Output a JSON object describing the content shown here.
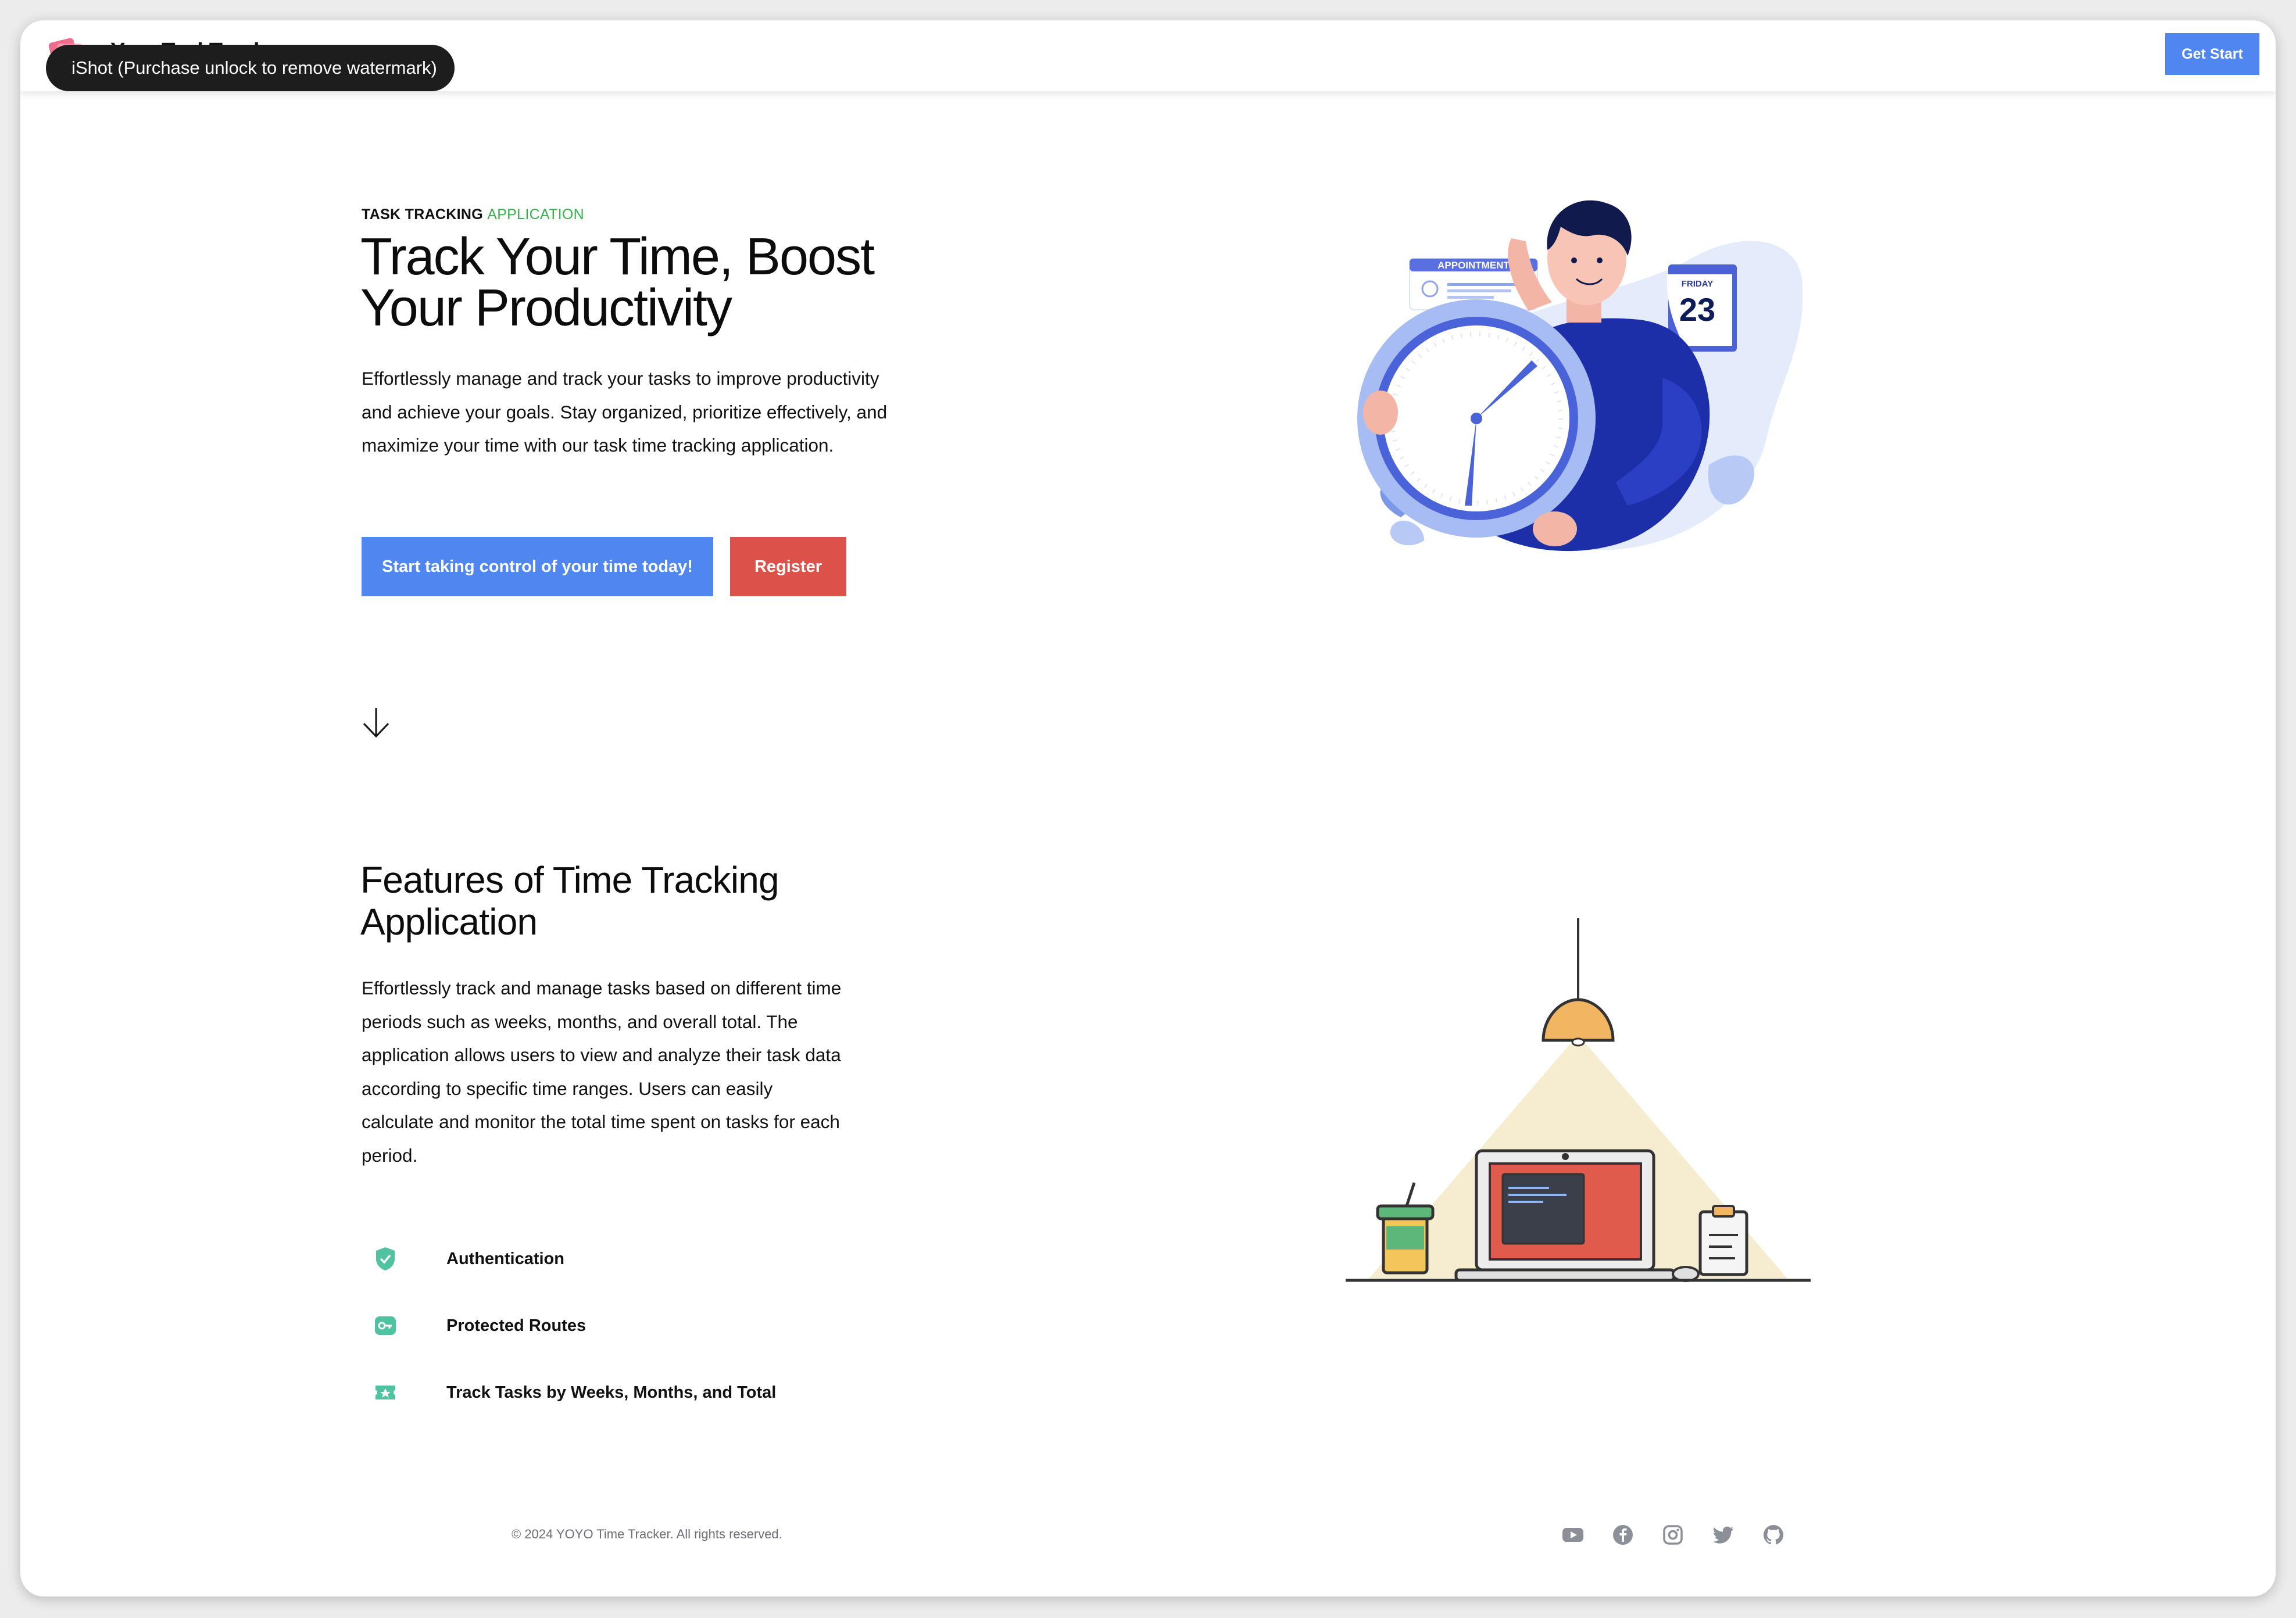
{
  "header": {
    "brand_name": "YoyoTaskTracker",
    "watermark": "iShot (Purchase unlock to remove watermark)",
    "get_start_label": "Get Start"
  },
  "hero": {
    "eyebrow_main": "TASK TRACKING ",
    "eyebrow_accent": "APPLICATION",
    "title": "Track Your Time, Boost Your Productivity",
    "description": "Effortlessly manage and track your tasks to improve productivity and achieve your goals. Stay organized, prioritize effectively, and maximize your time with our task time tracking application.",
    "primary_button": "Start taking control of your time today!",
    "register_button": "Register",
    "illustration": {
      "appointment_label": "APPOINTMENT",
      "calendar_day": "FRIDAY",
      "calendar_date": "23"
    }
  },
  "features": {
    "title": "Features of Time Tracking Application",
    "description": "Effortlessly track and manage tasks based on different time periods such as weeks, months, and overall total. The application allows users to view and analyze their task data according to specific time ranges. Users can easily calculate and monitor the total time spent on tasks for each period.",
    "items": [
      {
        "label": "Authentication",
        "icon": "shield-check-icon"
      },
      {
        "label": "Protected Routes",
        "icon": "key-icon"
      },
      {
        "label": "Track Tasks by Weeks, Months, and Total",
        "icon": "ticket-icon"
      }
    ]
  },
  "footer": {
    "copyright": "© 2024 YOYO Time Tracker. All rights reserved.",
    "social_icons": [
      "youtube-icon",
      "facebook-icon",
      "instagram-icon",
      "twitter-icon",
      "github-icon"
    ]
  },
  "colors": {
    "primary": "#4f86f0",
    "register": "#dc5149",
    "accent_green": "#38b24a",
    "feature_icon": "#4fc3a1",
    "footer_text": "#6a6f78"
  }
}
